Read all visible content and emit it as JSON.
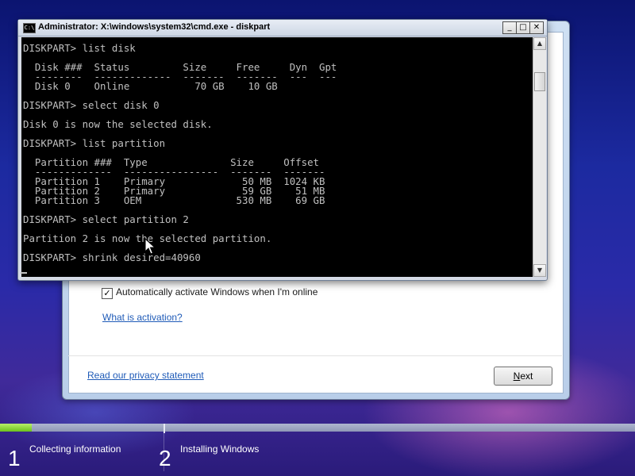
{
  "setup": {
    "checkbox_checked": true,
    "checkbox_mark": "✓",
    "checkbox_label": "Automatically activate Windows when I'm online",
    "what_is_activation_link": "What is activation?",
    "privacy_link": "Read our privacy statement",
    "next_button_label_underlined": "N",
    "next_button_label_rest": "ext"
  },
  "cmd": {
    "icon_label": "C:\\",
    "title": "Administrator: X:\\windows\\system32\\cmd.exe - diskpart",
    "buttons": {
      "minimize": "_",
      "maximize": "□",
      "close": "✕"
    },
    "console_lines": [
      "DISKPART> list disk",
      "",
      "  Disk ###  Status         Size     Free     Dyn  Gpt",
      "  --------  -------------  -------  -------  ---  ---",
      "  Disk 0    Online           70 GB    10 GB",
      "",
      "DISKPART> select disk 0",
      "",
      "Disk 0 is now the selected disk.",
      "",
      "DISKPART> list partition",
      "",
      "  Partition ###  Type              Size     Offset",
      "  -------------  ----------------  -------  -------",
      "  Partition 1    Primary             50 MB  1024 KB",
      "  Partition 2    Primary             59 GB    51 MB",
      "  Partition 3    OEM                530 MB    69 GB",
      "",
      "DISKPART> select partition 2",
      "",
      "Partition 2 is now the selected partition.",
      "",
      "DISKPART> shrink desired=40960"
    ],
    "scroll_up": "▲",
    "scroll_down": "▼"
  },
  "progress": {
    "fraction": 0.05,
    "fill_color": "#7bd12a"
  },
  "steps": [
    {
      "number": "1",
      "label": "Collecting information"
    },
    {
      "number": "2",
      "label": "Installing Windows"
    }
  ]
}
